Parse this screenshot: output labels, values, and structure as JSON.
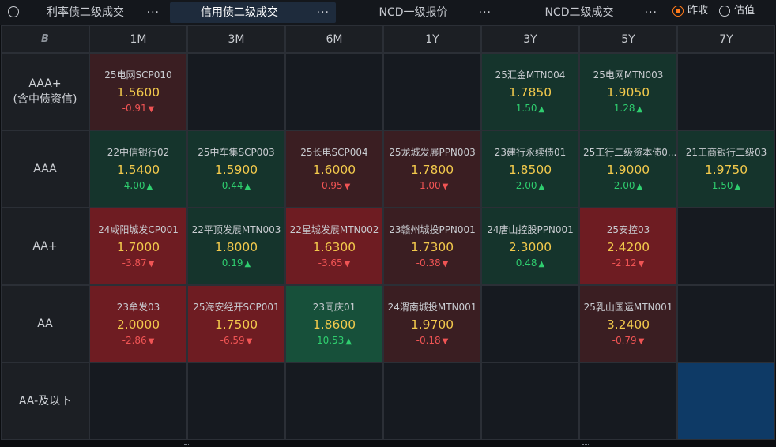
{
  "tabs": [
    {
      "label": "利率债二级成交",
      "active": false
    },
    {
      "label": "信用债二级成交",
      "active": true
    },
    {
      "label": "NCD一级报价",
      "active": false
    },
    {
      "label": "NCD二级成交",
      "active": false
    }
  ],
  "more_label": "···",
  "radio": {
    "option1": "昨收",
    "option2": "估值",
    "selected": "昨收"
  },
  "corner": "B",
  "columns": [
    "1M",
    "3M",
    "6M",
    "1Y",
    "3Y",
    "5Y",
    "7Y"
  ],
  "rows": [
    {
      "label": "AAA+",
      "sublabel": "(含中债资信)",
      "cells": [
        {
          "name": "25电网SCP010",
          "yield": "1.5600",
          "chg": "-0.91",
          "dir": "down"
        },
        null,
        null,
        null,
        {
          "name": "25汇金MTN004",
          "yield": "1.7850",
          "chg": "1.50",
          "dir": "up"
        },
        {
          "name": "25电网MTN003",
          "yield": "1.9050",
          "chg": "1.28",
          "dir": "up"
        },
        null
      ]
    },
    {
      "label": "AAA",
      "sublabel": "",
      "cells": [
        {
          "name": "22中信银行02",
          "yield": "1.5400",
          "chg": "4.00",
          "dir": "up"
        },
        {
          "name": "25中车集SCP003",
          "yield": "1.5900",
          "chg": "0.44",
          "dir": "up"
        },
        {
          "name": "25长电SCP004",
          "yield": "1.6000",
          "chg": "-0.95",
          "dir": "down"
        },
        {
          "name": "25龙城发展PPN003",
          "yield": "1.7800",
          "chg": "-1.00",
          "dir": "down"
        },
        {
          "name": "23建行永续债01",
          "yield": "1.8500",
          "chg": "2.00",
          "dir": "up"
        },
        {
          "name": "25工行二级资本债0...",
          "yield": "1.9000",
          "chg": "2.00",
          "dir": "up"
        },
        {
          "name": "21工商银行二级03",
          "yield": "1.9750",
          "chg": "1.50",
          "dir": "up"
        }
      ]
    },
    {
      "label": "AA+",
      "sublabel": "",
      "cells": [
        {
          "name": "24咸阳城发CP001",
          "yield": "1.7000",
          "chg": "-3.87",
          "dir": "down",
          "heat": "down"
        },
        {
          "name": "22平顶发展MTN003",
          "yield": "1.8000",
          "chg": "0.19",
          "dir": "up"
        },
        {
          "name": "22星城发展MTN002",
          "yield": "1.6300",
          "chg": "-3.65",
          "dir": "down",
          "heat": "down"
        },
        {
          "name": "23赣州城投PPN001",
          "yield": "1.7300",
          "chg": "-0.38",
          "dir": "down"
        },
        {
          "name": "24唐山控股PPN001",
          "yield": "2.3000",
          "chg": "0.48",
          "dir": "up"
        },
        {
          "name": "25安控03",
          "yield": "2.4200",
          "chg": "-2.12",
          "dir": "down",
          "heat": "down"
        },
        null
      ]
    },
    {
      "label": "AA",
      "sublabel": "",
      "cells": [
        {
          "name": "23牟发03",
          "yield": "2.0000",
          "chg": "-2.86",
          "dir": "down",
          "heat": "down"
        },
        {
          "name": "25海安经开SCP001",
          "yield": "1.7500",
          "chg": "-6.59",
          "dir": "down",
          "heat": "strong-down"
        },
        {
          "name": "23同庆01",
          "yield": "1.8600",
          "chg": "10.53",
          "dir": "up",
          "heat": "strong-up"
        },
        {
          "name": "24渭南城投MTN001",
          "yield": "1.9700",
          "chg": "-0.18",
          "dir": "down"
        },
        null,
        {
          "name": "25乳山国运MTN001",
          "yield": "3.2400",
          "chg": "-0.79",
          "dir": "down"
        },
        null
      ]
    },
    {
      "label": "AA-及以下",
      "sublabel": "",
      "cells": [
        null,
        null,
        null,
        null,
        null,
        null,
        {
          "highlight": true
        }
      ]
    }
  ],
  "colors": {
    "up": "#2fce6f",
    "down": "#f05454",
    "yield": "#f2c94c",
    "accent": "#ff7a1a"
  }
}
